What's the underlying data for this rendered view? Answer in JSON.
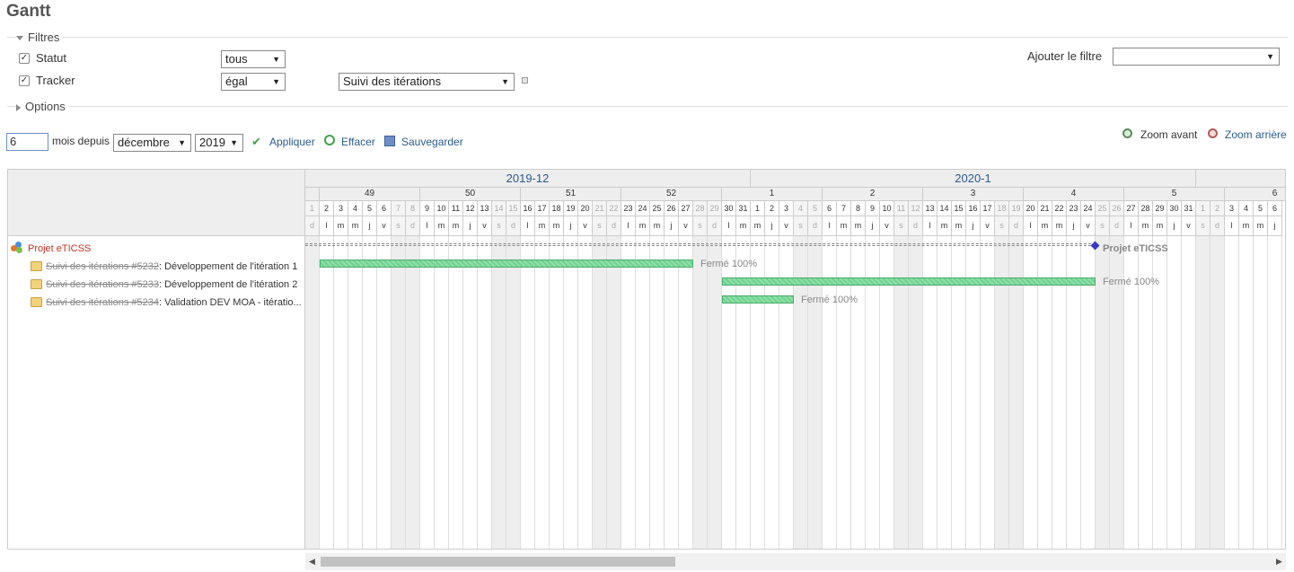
{
  "page": {
    "title": "Gantt"
  },
  "filters": {
    "legend": "Filtres",
    "rows": [
      {
        "checked": true,
        "label": "Statut",
        "operator": "tous",
        "value": ""
      },
      {
        "checked": true,
        "label": "Tracker",
        "operator": "égal",
        "value": "Suivi des itérations"
      }
    ],
    "add_filter_label": "Ajouter le filtre",
    "add_filter_value": ""
  },
  "options": {
    "legend": "Options"
  },
  "period": {
    "months": "6",
    "since_label": "mois depuis",
    "month": "décembre",
    "year": "2019"
  },
  "actions": {
    "apply": "Appliquer",
    "clear": "Effacer",
    "save": "Sauvegarder"
  },
  "zoom": {
    "in": "Zoom avant",
    "out": "Zoom arrière"
  },
  "colors": {
    "bar": "#6dd38f",
    "link": "#2a5b8f",
    "project": "#c7301b",
    "milestone": "#3a37c9"
  },
  "gantt": {
    "months": [
      "2019-12",
      "2020-1"
    ],
    "weeks": [
      "49",
      "50",
      "51",
      "52",
      "1",
      "2",
      "3",
      "4",
      "5",
      "6"
    ],
    "day_letters": [
      "l",
      "m",
      "m",
      "j",
      "v",
      "s",
      "d"
    ],
    "project": {
      "name": "Projet eTICSS",
      "end_label": "Projet eTICSS"
    },
    "issues": [
      {
        "ref": "Suivi des itérations #5232",
        "subject": ": Développement de l'itération 1",
        "status": "Fermé 100%",
        "start": "2019-12-02",
        "end": "2019-12-27"
      },
      {
        "ref": "Suivi des itérations #5233",
        "subject": ": Développement de l'itération 2",
        "status": "Fermé 100%",
        "start": "2019-12-30",
        "end": "2020-01-24"
      },
      {
        "ref": "Suivi des itérations #5234",
        "subject": ": Validation DEV MOA - itératio...",
        "status": "Fermé 100%",
        "start": "2019-12-30",
        "end": "2020-01-03"
      }
    ]
  }
}
